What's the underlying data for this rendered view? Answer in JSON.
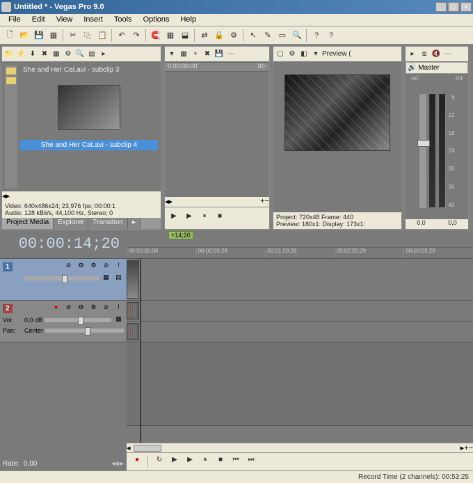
{
  "window": {
    "title": "Untitled * - Vegas Pro 9.0"
  },
  "menu": [
    "File",
    "Edit",
    "View",
    "Insert",
    "Tools",
    "Options",
    "Help"
  ],
  "project_media": {
    "items": [
      {
        "name": "She and Her Cat.avi - subclip 3",
        "selected": false
      },
      {
        "name": "She and Her Cat.avi - subclip 4",
        "selected": true
      }
    ],
    "video_info": "Video: 640x486x24; 23,976 fps; 00:00:1",
    "audio_info": "Audio: 128 kBit/s, 44,100 Hz, Stereo; 0",
    "tabs": [
      "Project Media",
      "Explorer",
      "Transition"
    ]
  },
  "trimmer": {
    "start": "0:00:00:00",
    "end": "00:"
  },
  "preview": {
    "label": "Preview (",
    "project_line": "Project: 720x48 Frame: 440",
    "preview_line": "Preview: 180x1: Display: 173x1:"
  },
  "mixer": {
    "label": "Master",
    "top_label_l": "-Inf.",
    "top_label_r": "-Inf.",
    "scale": [
      "6",
      "12",
      "18",
      "24",
      "30",
      "36",
      "42"
    ],
    "bottom_l": "0,0",
    "bottom_r": "0,0"
  },
  "timeline": {
    "timecode": "00:00:14;20",
    "marker": "+14;20",
    "ruler": [
      "00:00:00;00",
      "00:00:59;28",
      "00:01:59;28",
      "00:02:59;29",
      "00:03:59;29"
    ],
    "tracks": {
      "video": {
        "num": "1"
      },
      "audio": {
        "num": "2",
        "vol_label": "Vol:",
        "vol_value": "0,0 dB",
        "pan_label": "Pan:",
        "pan_value": "Center"
      }
    },
    "rate_label": "Rate:",
    "rate_value": "0,00"
  },
  "status": {
    "record_time": "Record Time (2 channels): 00:53:25"
  }
}
